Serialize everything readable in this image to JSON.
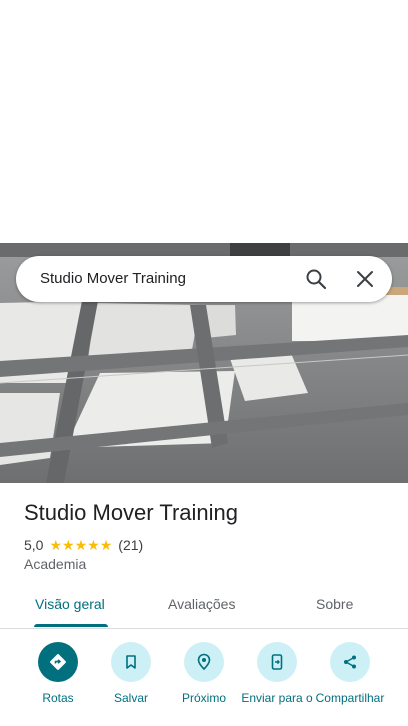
{
  "search": {
    "query": "Studio Mover Training"
  },
  "place": {
    "name": "Studio Mover Training",
    "rating": "5,0",
    "stars": 5,
    "review_count": "(21)",
    "category": "Academia"
  },
  "tabs": [
    {
      "label": "Visão geral",
      "active": true
    },
    {
      "label": "Avaliações",
      "active": false
    },
    {
      "label": "Sobre",
      "active": false
    }
  ],
  "actions": [
    {
      "label": "Rotas",
      "icon": "directions-icon"
    },
    {
      "label": "Salvar",
      "icon": "bookmark-icon"
    },
    {
      "label": "Próximo",
      "icon": "nearby-icon"
    },
    {
      "label": "Enviar para o",
      "icon": "send-to-phone-icon"
    },
    {
      "label": "Compartilhar",
      "icon": "share-icon"
    }
  ],
  "colors": {
    "accent": "#00707f",
    "chip": "#cdf0f6",
    "star": "#fbbc04"
  }
}
